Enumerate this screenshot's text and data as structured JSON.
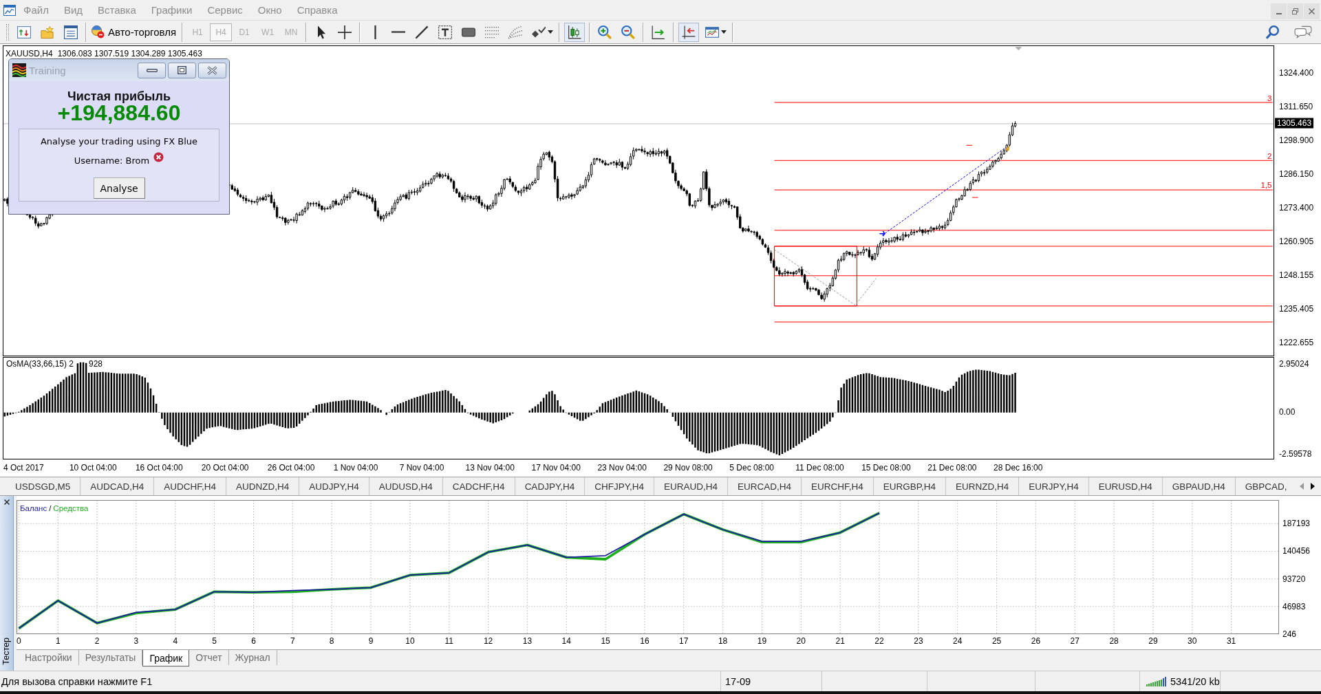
{
  "menu": [
    "Файл",
    "Вид",
    "Вставка",
    "Графики",
    "Сервис",
    "Окно",
    "Справка"
  ],
  "toolbar": {
    "auto_trading": "Авто-торговля",
    "periods": [
      {
        "label": "H1",
        "selected": false,
        "disabled": true
      },
      {
        "label": "H4",
        "selected": true,
        "disabled": true
      },
      {
        "label": "D1",
        "selected": false,
        "disabled": true
      },
      {
        "label": "W1",
        "selected": false,
        "disabled": true
      },
      {
        "label": "MN",
        "selected": false,
        "disabled": true
      }
    ],
    "candlesticks": {
      "selected": true
    },
    "chart_shift": {
      "selected": true
    }
  },
  "chart": {
    "symbol": "XAUUSD,H4",
    "ohlc": "1306.083 1307.519 1304.289 1305.463",
    "level_labels": [
      "3",
      "2",
      "1,5"
    ],
    "price_axis": [
      "1324.400",
      "1311.650",
      "1298.900",
      "1286.150",
      "1273.400",
      "1260.905",
      "1248.155",
      "1235.405",
      "1222.655"
    ],
    "current_price": "1305.463",
    "indicator": {
      "label": "OsMA(33,66,15) 2",
      "label_tail": "928",
      "axis": [
        "2.95024",
        "0.00",
        "-2.59578"
      ]
    },
    "time_axis": [
      "4 Oct 2017",
      "10 Oct 04:00",
      "16 Oct 04:00",
      "20 Oct 04:00",
      "26 Oct 04:00",
      "1 Nov 04:00",
      "7 Nov 04:00",
      "13 Nov 04:00",
      "17 Nov 04:00",
      "23 Nov 04:00",
      "29 Nov 08:00",
      "5 Dec 08:00",
      "11 Dec 08:00",
      "15 Dec 08:00",
      "21 Dec 08:00",
      "28 Dec 16:00"
    ]
  },
  "training_dialog": {
    "title": "Training",
    "heading": "Чистая прибыль",
    "profit": "+194,884.60",
    "message": "Analyse your trading using FX Blue",
    "username": "Username: Brom",
    "button": "Analyse"
  },
  "symbol_tabs": [
    {
      "label": "USDSGD,M5",
      "selected": false
    },
    {
      "label": "AUDCAD,H4",
      "selected": false
    },
    {
      "label": "AUDCHF,H4",
      "selected": false
    },
    {
      "label": "AUDNZD,H4",
      "selected": false
    },
    {
      "label": "AUDJPY,H4",
      "selected": false
    },
    {
      "label": "AUDUSD,H4",
      "selected": false
    },
    {
      "label": "CADCHF,H4",
      "selected": false
    },
    {
      "label": "CADJPY,H4",
      "selected": false
    },
    {
      "label": "CHFJPY,H4",
      "selected": false
    },
    {
      "label": "EURAUD,H4",
      "selected": false
    },
    {
      "label": "EURCAD,H4",
      "selected": false
    },
    {
      "label": "EURCHF,H4",
      "selected": false
    },
    {
      "label": "EURGBP,H4",
      "selected": false
    },
    {
      "label": "EURNZD,H4",
      "selected": false
    },
    {
      "label": "EURJPY,H4",
      "selected": false
    },
    {
      "label": "EURUSD,H4",
      "selected": false
    },
    {
      "label": "GBPAUD,H4",
      "selected": false
    },
    {
      "label": "GBPCAD,",
      "selected": false
    }
  ],
  "tester": {
    "title": "Тестер",
    "legend_separator": "/",
    "chart_data": [
      {
        "type": "line",
        "x": [
          0,
          1,
          2,
          3,
          4,
          5,
          6,
          7,
          8,
          9,
          10,
          11,
          12,
          13,
          14,
          15,
          16,
          17,
          18,
          19,
          20,
          21,
          22
        ],
        "series": [
          {
            "name": "Баланс",
            "color": "#1c1ca0",
            "values": [
              10000,
              57000,
              19000,
              37000,
              42000,
              72000,
              71000,
              74000,
              76000,
              79000,
              100000,
              104000,
              139000,
              151000,
              130000,
              133000,
              169000,
              203000,
              177000,
              157000,
              157000,
              172000,
              205000
            ]
          },
          {
            "name": "Средства",
            "color": "#1fb01f",
            "values": [
              10000,
              57000,
              19000,
              36000,
              42000,
              72000,
              71000,
              72000,
              76000,
              79000,
              100000,
              104000,
              139000,
              151000,
              130000,
              127000,
              169000,
              203000,
              177000,
              156000,
              156000,
              172000,
              205000
            ]
          }
        ],
        "xlim": [
          -0.06,
          32.22
        ],
        "ylim": [
          246,
          227000
        ],
        "xticks": [
          0,
          1,
          2,
          3,
          4,
          5,
          6,
          7,
          8,
          9,
          10,
          11,
          12,
          13,
          14,
          15,
          16,
          17,
          18,
          19,
          20,
          21,
          22,
          23,
          24,
          25,
          26,
          27,
          28,
          29,
          30,
          31
        ],
        "yticks": [
          246,
          46983,
          93720,
          140456,
          187193
        ],
        "grid": true,
        "legend": "top-left"
      }
    ],
    "tabs": [
      {
        "label": "Настройки",
        "selected": false
      },
      {
        "label": "Результаты",
        "selected": false
      },
      {
        "label": "График",
        "selected": true
      },
      {
        "label": "Отчет",
        "selected": false
      },
      {
        "label": "Журнал",
        "selected": false
      }
    ]
  },
  "status_bar": {
    "hint": "Для вызова справки нажмите F1",
    "time": "17-09",
    "traffic": "5341/20 kb"
  }
}
